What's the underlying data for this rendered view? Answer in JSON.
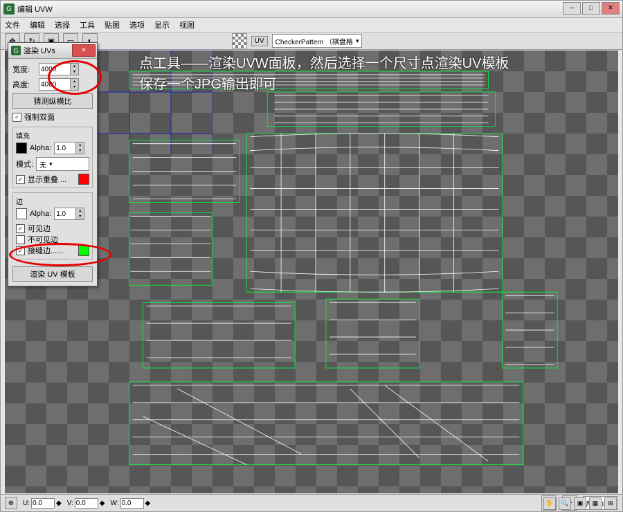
{
  "window": {
    "title": "编辑 UVW"
  },
  "menu": [
    "文件",
    "编辑",
    "选择",
    "工具",
    "贴图",
    "选项",
    "显示",
    "视图"
  ],
  "toolbar": {
    "uv": "UV",
    "pattern": "CheckerPattern （棋盘格"
  },
  "annotation": {
    "line1": "点工具——渲染UVW面板，然后选择一个尺寸点渲染UV模板",
    "line2": "保存一个JPG输出即可"
  },
  "renderPanel": {
    "title": "渲染 UVs",
    "widthLabel": "宽度:",
    "width": "4000",
    "heightLabel": "高度:",
    "height": "4000",
    "guessAspect": "猜测纵横比",
    "force2Side": "强制双面",
    "fill": "填充",
    "alpha": "Alpha:",
    "alphaVal": "1.0",
    "mode": "模式:",
    "modeVal": "无",
    "showOverlap": "显示重叠 ...",
    "edges": "边",
    "visibleEdge": "可见边",
    "invisibleEdge": "不可见边",
    "seamEdge": "接缝边......",
    "renderBtn": "渲染 UV 模板"
  },
  "status": {
    "u": "U:",
    "uVal": "0.0",
    "v": "V:",
    "vVal": "0.0",
    "w": "W:",
    "wVal": "0.0",
    "allId": "所有 ID"
  }
}
